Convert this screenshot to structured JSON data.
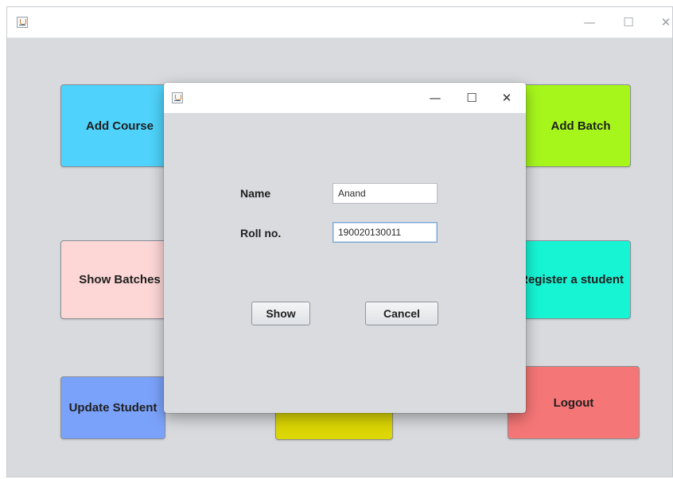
{
  "main_window": {
    "controls": {
      "minimize": "—",
      "maximize": "☐",
      "close": "✕"
    },
    "tiles": [
      {
        "name": "add-course-button",
        "label": "Add Course",
        "color": "#4fd2fb"
      },
      {
        "name": "add-batch-button",
        "label": "Add Batch",
        "color": "#a6f61c"
      },
      {
        "name": "show-batches-button",
        "label": "Show Batches",
        "color": "#fdd6d6"
      },
      {
        "name": "register-student-button",
        "label": "Register a student",
        "color": "#17f4d4"
      },
      {
        "name": "update-student-button",
        "label": "Update Student",
        "color": "#7ba2fb"
      },
      {
        "name": "yellow-button",
        "label": "",
        "color": "#dcd604"
      },
      {
        "name": "logout-button",
        "label": "Logout",
        "color": "#f57676"
      }
    ]
  },
  "dialog": {
    "controls": {
      "minimize": "—",
      "maximize": "☐",
      "close": "✕"
    },
    "name_label": "Name",
    "name_value": "Anand",
    "roll_label": "Roll no.",
    "roll_value": "190020130011",
    "show_label": "Show",
    "cancel_label": "Cancel"
  }
}
